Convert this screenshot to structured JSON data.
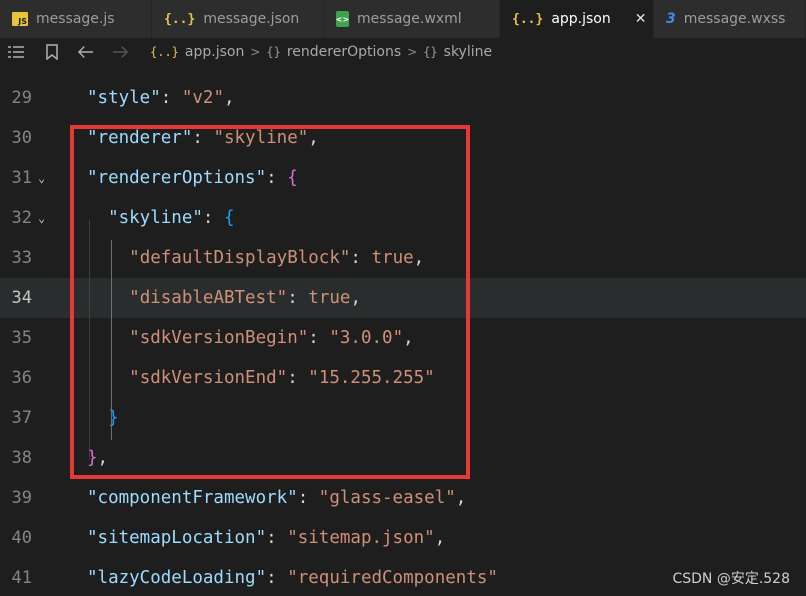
{
  "tabs": [
    {
      "label": "message.js",
      "icon": "js-file-icon",
      "icon_glyph": "JS",
      "active": false
    },
    {
      "label": "message.json",
      "icon": "json-file-icon",
      "icon_glyph": "{..}",
      "active": false
    },
    {
      "label": "message.wxml",
      "icon": "wxml-file-icon",
      "icon_glyph": "<>",
      "active": false
    },
    {
      "label": "app.json",
      "icon": "json-file-icon",
      "icon_glyph": "{..}",
      "active": true
    },
    {
      "label": "message.wxss",
      "icon": "css-file-icon",
      "icon_glyph": "3",
      "active": false
    }
  ],
  "tab_close_glyph": "✕",
  "breadcrumb": {
    "file": "app.json",
    "file_icon_glyph": "{..}",
    "obj_icon_glyph": "{}",
    "items": [
      "rendererOptions",
      "skyline"
    ],
    "sep": ">"
  },
  "editor": {
    "current_line": 34,
    "lines": [
      {
        "n": "29",
        "tokens": [
          [
            "k",
            "\"style\""
          ],
          [
            "p",
            ": "
          ],
          [
            "s",
            "\"v2\""
          ],
          [
            "p",
            ","
          ]
        ]
      },
      {
        "n": "30",
        "tokens": [
          [
            "k",
            "\"renderer\""
          ],
          [
            "p",
            ": "
          ],
          [
            "s",
            "\"skyline\""
          ],
          [
            "p",
            ","
          ]
        ]
      },
      {
        "n": "31",
        "fold": "⌄",
        "tokens": [
          [
            "k",
            "\"rendererOptions\""
          ],
          [
            "p",
            ": "
          ],
          [
            "br1",
            "{"
          ]
        ]
      },
      {
        "n": "32",
        "fold": "⌄",
        "tokens": [
          [
            "p",
            "  "
          ],
          [
            "k",
            "\"skyline\""
          ],
          [
            "p",
            ": "
          ],
          [
            "br2",
            "{"
          ]
        ]
      },
      {
        "n": "33",
        "tokens": [
          [
            "p",
            "    "
          ],
          [
            "kk",
            "\"defaultDisplayBlock\""
          ],
          [
            "p",
            ": "
          ],
          [
            "kk",
            "true"
          ],
          [
            "p",
            ","
          ]
        ]
      },
      {
        "n": "34",
        "tokens": [
          [
            "p",
            "    "
          ],
          [
            "kk",
            "\"disableABTest\""
          ],
          [
            "p",
            ": "
          ],
          [
            "kk",
            "true"
          ],
          [
            "p",
            ","
          ]
        ]
      },
      {
        "n": "35",
        "tokens": [
          [
            "p",
            "    "
          ],
          [
            "kk",
            "\"sdkVersionBegin\""
          ],
          [
            "p",
            ": "
          ],
          [
            "kk",
            "\"3.0.0\""
          ],
          [
            "p",
            ","
          ]
        ]
      },
      {
        "n": "36",
        "tokens": [
          [
            "p",
            "    "
          ],
          [
            "kk",
            "\"sdkVersionEnd\""
          ],
          [
            "p",
            ": "
          ],
          [
            "kk",
            "\"15.255.255\""
          ]
        ]
      },
      {
        "n": "37",
        "tokens": [
          [
            "p",
            "  "
          ],
          [
            "br2",
            "}"
          ]
        ]
      },
      {
        "n": "38",
        "tokens": [
          [
            "br1",
            "}"
          ],
          [
            "p",
            ","
          ]
        ]
      },
      {
        "n": "39",
        "tokens": [
          [
            "k",
            "\"componentFramework\""
          ],
          [
            "p",
            ": "
          ],
          [
            "s",
            "\"glass-easel\""
          ],
          [
            "p",
            ","
          ]
        ]
      },
      {
        "n": "40",
        "tokens": [
          [
            "k",
            "\"sitemapLocation\""
          ],
          [
            "p",
            ": "
          ],
          [
            "s",
            "\"sitemap.json\""
          ],
          [
            "p",
            ","
          ]
        ]
      },
      {
        "n": "41",
        "tokens": [
          [
            "k",
            "\"lazyCodeLoading\""
          ],
          [
            "p",
            ": "
          ],
          [
            "s",
            "\"requiredComponents\""
          ]
        ]
      }
    ]
  },
  "top_fragment": "},",
  "watermark": "CSDN @安定.528",
  "colors": {
    "background": "#1e1e1e",
    "key": "#9cdcfe",
    "string": "#ce9178",
    "highlight_box": "#e53935"
  }
}
